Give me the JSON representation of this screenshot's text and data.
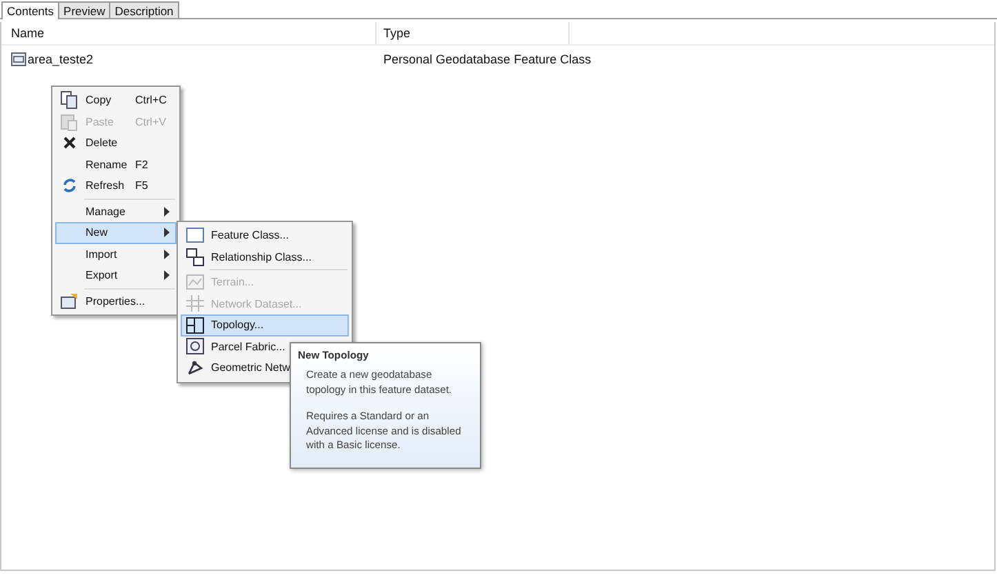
{
  "tabs": [
    {
      "label": "Contents",
      "selected": true
    },
    {
      "label": "Preview",
      "selected": false
    },
    {
      "label": "Description",
      "selected": false
    }
  ],
  "table": {
    "columns": [
      "Name",
      "Type"
    ],
    "rows": [
      {
        "name": "area_teste2",
        "type": "Personal Geodatabase Feature Class"
      }
    ]
  },
  "context_menu": {
    "items": [
      {
        "label": "Copy",
        "shortcut": "Ctrl+C",
        "disabled": false,
        "submenu": false,
        "selected": false,
        "separator_before": false
      },
      {
        "label": "Paste",
        "shortcut": "Ctrl+V",
        "disabled": true,
        "submenu": false,
        "selected": false,
        "separator_before": false
      },
      {
        "label": "Delete",
        "disabled": false,
        "submenu": false,
        "selected": false,
        "separator_before": false
      },
      {
        "label": "Rename",
        "shortcut": "F2",
        "disabled": false,
        "submenu": false,
        "selected": false,
        "separator_before": false
      },
      {
        "label": "Refresh",
        "shortcut": "F5",
        "disabled": false,
        "submenu": false,
        "selected": false,
        "separator_before": false
      },
      {
        "label": "Manage",
        "disabled": false,
        "submenu": true,
        "selected": false,
        "separator_before": true
      },
      {
        "label": "New",
        "disabled": false,
        "submenu": true,
        "selected": true,
        "separator_before": false
      },
      {
        "label": "Import",
        "disabled": false,
        "submenu": true,
        "selected": false,
        "separator_before": false
      },
      {
        "label": "Export",
        "disabled": false,
        "submenu": true,
        "selected": false,
        "separator_before": false
      },
      {
        "label": "Properties...",
        "disabled": false,
        "submenu": false,
        "selected": false,
        "separator_before": true
      }
    ]
  },
  "submenu": {
    "items": [
      {
        "label": "Feature Class...",
        "disabled": false,
        "selected": false,
        "separator_before": false
      },
      {
        "label": "Relationship Class...",
        "disabled": false,
        "selected": false,
        "separator_before": false
      },
      {
        "label": "Terrain...",
        "disabled": true,
        "selected": false,
        "separator_before": true
      },
      {
        "label": "Network Dataset...",
        "disabled": true,
        "selected": false,
        "separator_before": false
      },
      {
        "label": "Topology...",
        "disabled": false,
        "selected": true,
        "separator_before": false
      },
      {
        "label": "Parcel Fabric...",
        "disabled": false,
        "selected": false,
        "separator_before": false
      },
      {
        "label": "Geometric Netw",
        "disabled": false,
        "selected": false,
        "separator_before": false
      }
    ]
  },
  "tooltip": {
    "title": "New Topology",
    "paragraphs": [
      "Create a new geodatabase topology in this feature dataset.",
      "Requires a Standard or an Advanced license and is disabled with a Basic license."
    ]
  }
}
